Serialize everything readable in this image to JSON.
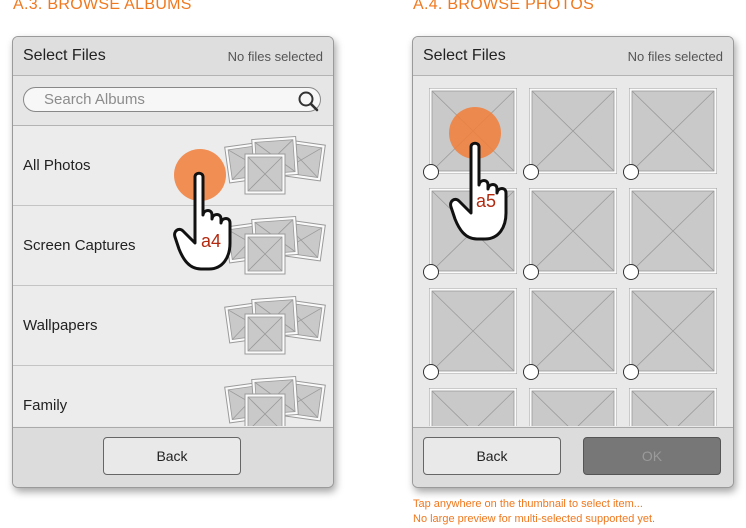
{
  "screens": {
    "albums": {
      "section_title": "A.3. BROWSE ALBUMS",
      "header_title": "Select Files",
      "header_status": "No files selected",
      "search_placeholder": "Search Albums",
      "albums": [
        "All Photos",
        "Screen Captures",
        "Wallpapers",
        "Family"
      ],
      "back_label": "Back",
      "gesture_label": "a4"
    },
    "photos": {
      "section_title": "A.4. BROWSE PHOTOS",
      "header_title": "Select Files",
      "header_status": "No files selected",
      "back_label": "Back",
      "ok_label": "OK",
      "gesture_label": "a5",
      "notes": [
        "Tap anywhere on the thumbnail to select item...",
        "No large preview for multi-selected supported yet."
      ]
    }
  },
  "colors": {
    "accent": "#f0781e",
    "touch": "#f27e3a",
    "gesture_label": "#b22a10"
  }
}
